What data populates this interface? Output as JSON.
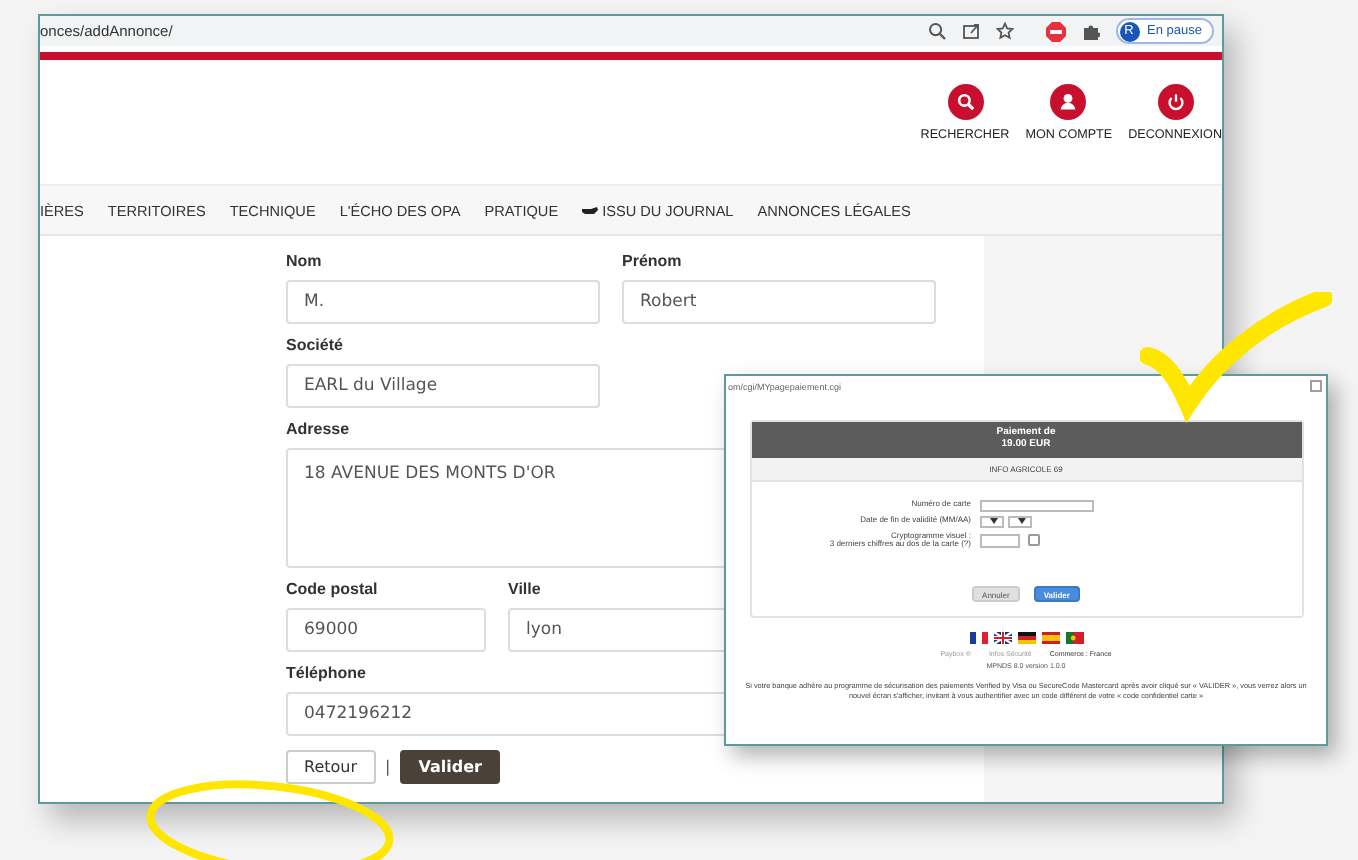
{
  "browser": {
    "url": "onces/addAnnonce/",
    "profile_initial": "R",
    "profile_status": "En pause"
  },
  "header_actions": [
    {
      "label": "RECHERCHER",
      "kind": "search"
    },
    {
      "label": "MON COMPTE",
      "kind": "account"
    },
    {
      "label": "DECONNEXION",
      "kind": "power"
    }
  ],
  "nav": [
    {
      "label": "IÈRES",
      "kind": "text"
    },
    {
      "label": "TERRITOIRES",
      "kind": "text"
    },
    {
      "label": "TECHNIQUE",
      "kind": "text"
    },
    {
      "label": "L'ÉCHO DES OPA",
      "kind": "text"
    },
    {
      "label": "PRATIQUE",
      "kind": "text"
    },
    {
      "label": "ISSU DU JOURNAL",
      "kind": "icon"
    },
    {
      "label": "ANNONCES LÉGALES",
      "kind": "text"
    }
  ],
  "form": {
    "rows": [
      [
        {
          "label": "Nom",
          "value": "M.",
          "kind": "half"
        },
        {
          "label": "Prénom",
          "value": "Robert",
          "kind": "half"
        }
      ],
      [
        {
          "label": "Société",
          "value": "EARL du Village",
          "kind": "half"
        }
      ],
      [
        {
          "label": "Adresse",
          "value": "18 AVENUE DES MONTS D'OR",
          "kind": "textarea"
        }
      ],
      [
        {
          "label": "Code postal",
          "value": "69000",
          "kind": "short"
        },
        {
          "label": "Ville",
          "value": "lyon",
          "kind": "fill"
        }
      ],
      [
        {
          "label": "Téléphone",
          "value": "0472196212",
          "kind": "full"
        }
      ]
    ],
    "buttons": [
      {
        "label": "Retour",
        "kind": "secondary"
      },
      {
        "label": "Valider",
        "kind": "primary"
      }
    ],
    "separator": "|"
  },
  "payment_popup": {
    "url": "om/cgi/MYpagepaiement.cgi",
    "title_lines": [
      "Paiement de",
      "19.00 EUR"
    ],
    "merchant": "INFO AGRICOLE 69",
    "rows": [
      {
        "lines": [
          "Numéro de carte"
        ],
        "kind": "text"
      },
      {
        "lines": [
          "Date de fin de validité (MM/AA)"
        ],
        "kind": "date"
      },
      {
        "lines": [
          "Cryptogramme visuel :",
          "3 derniers chiffres au dos de la carte (?)"
        ],
        "kind": "cvv",
        "checked": false
      }
    ],
    "buttons": [
      {
        "label": "Annuler",
        "kind": "secondary"
      },
      {
        "label": "Valider",
        "kind": "primary"
      }
    ],
    "links": [
      "Paybox ®",
      "Infos Sécurité",
      "Commerce : France"
    ],
    "version": "MPNDS 8.0 version 1.0.0",
    "notice": "Si votre banque adhère au programme de sécurisation des paiements Verified by Visa ou SecureCode Mastercard après avoir cliqué sur « VALIDER », vous verrez alors un nouvel écran s'afficher, invitant à vous authentifier avec un code différent de votre « code confidentiel carte »"
  }
}
